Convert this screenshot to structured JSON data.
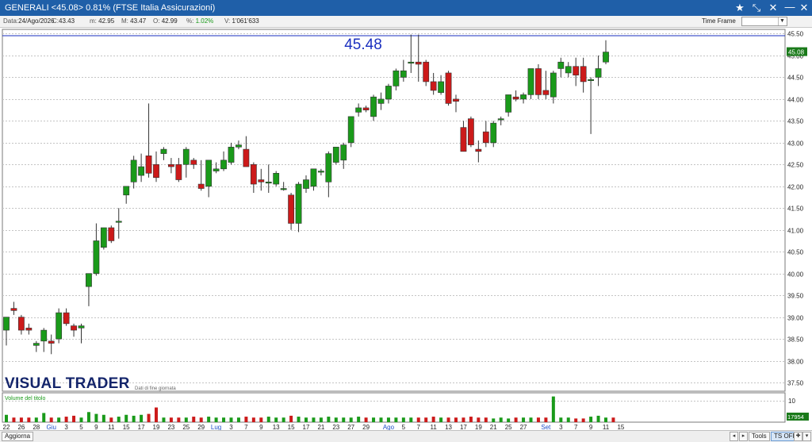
{
  "window": {
    "title": "GENERALI <45.08> 0.81%  (FTSE Italia Assicurazioni)",
    "buttons": [
      "★",
      "⤡",
      "✕",
      "—",
      "▢",
      "✕"
    ]
  },
  "infobar": {
    "date_label": "Data:",
    "date": "24/Ago/2026",
    "close_label": "C:",
    "close": "43.43",
    "min_label": "m:",
    "min": "42.95",
    "max_label": "M:",
    "max": "43.47",
    "open_label": "O:",
    "open": "42.99",
    "pct_label": "%:",
    "pct": "1.02%",
    "vol_label": "V:",
    "vol": "1'061'633",
    "timeframe_label": "Time Frame",
    "timeframe_value": ""
  },
  "chart": {
    "highlight_price": "45.48",
    "last_price_label": "45.08",
    "volume_title": "Volume del titolo",
    "volume_scale_label": "10",
    "volume_last_label": "17954",
    "brand": "VISUAL TRADER",
    "brand_note": "Dati di fine giornata",
    "colors": {
      "up": "#1a9a1a",
      "down": "#cc1a1a",
      "highlight": "#1a2fbf",
      "month": "#1f4fc8"
    }
  },
  "statusbar": {
    "refresh": "Aggiorna",
    "tools": "Tools",
    "tsoff": "TS OFF"
  },
  "chart_data": {
    "type": "candlestick",
    "title": "",
    "xlabel": "",
    "ylabel": "",
    "ylim": [
      37.3,
      45.6
    ],
    "yticks": [
      37.5,
      38.0,
      38.5,
      39.0,
      39.5,
      40.0,
      40.5,
      41.0,
      41.5,
      42.0,
      42.5,
      43.0,
      43.5,
      44.0,
      44.5,
      45.0,
      45.5
    ],
    "x_labels": [
      {
        "i": 0,
        "t": "22"
      },
      {
        "i": 2,
        "t": "26"
      },
      {
        "i": 4,
        "t": "28"
      },
      {
        "i": 6,
        "t": "Giu",
        "month": true
      },
      {
        "i": 8,
        "t": "3"
      },
      {
        "i": 10,
        "t": "5"
      },
      {
        "i": 12,
        "t": "9"
      },
      {
        "i": 14,
        "t": "11"
      },
      {
        "i": 16,
        "t": "15"
      },
      {
        "i": 18,
        "t": "17"
      },
      {
        "i": 20,
        "t": "19"
      },
      {
        "i": 22,
        "t": "23"
      },
      {
        "i": 24,
        "t": "25"
      },
      {
        "i": 26,
        "t": "29"
      },
      {
        "i": 28,
        "t": "Lug",
        "month": true
      },
      {
        "i": 30,
        "t": "3"
      },
      {
        "i": 32,
        "t": "7"
      },
      {
        "i": 34,
        "t": "9"
      },
      {
        "i": 36,
        "t": "13"
      },
      {
        "i": 38,
        "t": "15"
      },
      {
        "i": 40,
        "t": "17"
      },
      {
        "i": 42,
        "t": "21"
      },
      {
        "i": 44,
        "t": "23"
      },
      {
        "i": 46,
        "t": "27"
      },
      {
        "i": 48,
        "t": "29"
      },
      {
        "i": 51,
        "t": "Ago",
        "month": true
      },
      {
        "i": 53,
        "t": "5"
      },
      {
        "i": 55,
        "t": "7"
      },
      {
        "i": 57,
        "t": "11"
      },
      {
        "i": 59,
        "t": "13"
      },
      {
        "i": 61,
        "t": "17"
      },
      {
        "i": 63,
        "t": "19"
      },
      {
        "i": 65,
        "t": "21"
      },
      {
        "i": 67,
        "t": "25"
      },
      {
        "i": 69,
        "t": "27"
      },
      {
        "i": 72,
        "t": "Set",
        "month": true
      },
      {
        "i": 74,
        "t": "3"
      },
      {
        "i": 76,
        "t": "7"
      },
      {
        "i": 78,
        "t": "9"
      },
      {
        "i": 80,
        "t": "11"
      },
      {
        "i": 82,
        "t": "15"
      }
    ],
    "ohlc": [
      [
        38.7,
        39.0,
        38.35,
        39.0
      ],
      [
        39.2,
        39.35,
        39.05,
        39.15
      ],
      [
        39.0,
        39.05,
        38.6,
        38.7
      ],
      [
        38.75,
        38.85,
        38.6,
        38.7
      ],
      [
        38.35,
        38.45,
        38.2,
        38.4
      ],
      [
        38.45,
        38.75,
        38.2,
        38.7
      ],
      [
        38.45,
        38.6,
        38.15,
        38.4
      ],
      [
        38.5,
        39.2,
        38.4,
        39.1
      ],
      [
        39.1,
        39.2,
        38.8,
        38.85
      ],
      [
        38.8,
        38.85,
        38.55,
        38.7
      ],
      [
        38.75,
        38.85,
        38.4,
        38.8
      ],
      [
        39.7,
        40.0,
        39.25,
        40.0
      ],
      [
        40.0,
        41.15,
        39.95,
        40.75
      ],
      [
        40.6,
        41.05,
        40.55,
        41.05
      ],
      [
        41.05,
        41.1,
        40.7,
        40.75
      ],
      [
        41.2,
        41.5,
        40.8,
        41.2
      ],
      [
        41.8,
        42.0,
        41.6,
        42.0
      ],
      [
        42.1,
        42.7,
        41.95,
        42.6
      ],
      [
        42.25,
        42.75,
        42.1,
        42.45
      ],
      [
        42.7,
        43.9,
        42.2,
        42.3
      ],
      [
        42.5,
        42.8,
        42.1,
        42.2
      ],
      [
        42.75,
        42.9,
        42.6,
        42.85
      ],
      [
        42.5,
        42.65,
        42.3,
        42.45
      ],
      [
        42.5,
        42.65,
        42.1,
        42.15
      ],
      [
        42.5,
        42.9,
        42.2,
        42.85
      ],
      [
        42.6,
        42.65,
        42.4,
        42.5
      ],
      [
        42.05,
        42.6,
        41.9,
        41.95
      ],
      [
        42.0,
        42.6,
        41.75,
        42.6
      ],
      [
        42.35,
        42.55,
        42.3,
        42.4
      ],
      [
        42.4,
        42.8,
        42.35,
        42.6
      ],
      [
        42.55,
        43.0,
        42.5,
        42.9
      ],
      [
        42.9,
        43.05,
        42.85,
        42.95
      ],
      [
        42.85,
        43.15,
        42.5,
        42.45
      ],
      [
        42.5,
        42.55,
        41.85,
        42.05
      ],
      [
        42.15,
        42.4,
        41.9,
        42.1
      ],
      [
        42.1,
        42.5,
        41.85,
        42.1
      ],
      [
        42.05,
        42.35,
        42.0,
        42.3
      ],
      [
        41.95,
        42.1,
        41.9,
        41.95
      ],
      [
        41.8,
        41.85,
        41.0,
        41.15
      ],
      [
        41.15,
        42.1,
        40.95,
        42.05
      ],
      [
        41.95,
        42.25,
        41.85,
        42.15
      ],
      [
        42.0,
        42.4,
        41.9,
        42.4
      ],
      [
        42.35,
        42.4,
        42.25,
        42.35
      ],
      [
        42.1,
        42.8,
        41.75,
        42.75
      ],
      [
        42.55,
        42.9,
        42.5,
        42.9
      ],
      [
        42.6,
        43.0,
        42.4,
        42.95
      ],
      [
        43.0,
        43.6,
        42.9,
        43.6
      ],
      [
        43.7,
        43.9,
        43.6,
        43.8
      ],
      [
        43.8,
        43.85,
        43.7,
        43.75
      ],
      [
        43.6,
        44.1,
        43.5,
        44.05
      ],
      [
        43.9,
        44.15,
        43.75,
        44.0
      ],
      [
        44.0,
        44.35,
        43.9,
        44.3
      ],
      [
        44.3,
        44.7,
        44.2,
        44.65
      ],
      [
        44.5,
        44.9,
        44.4,
        44.65
      ],
      [
        44.85,
        45.48,
        44.6,
        44.85
      ],
      [
        44.85,
        45.48,
        44.4,
        44.8
      ],
      [
        44.85,
        44.9,
        44.3,
        44.4
      ],
      [
        44.4,
        44.6,
        44.1,
        44.2
      ],
      [
        44.15,
        44.55,
        44.1,
        44.4
      ],
      [
        44.6,
        44.65,
        43.85,
        43.9
      ],
      [
        44.0,
        44.1,
        43.7,
        43.95
      ],
      [
        43.35,
        43.5,
        42.8,
        42.8
      ],
      [
        43.55,
        43.6,
        42.9,
        42.95
      ],
      [
        42.85,
        43.05,
        42.55,
        42.8
      ],
      [
        43.25,
        43.5,
        42.9,
        43.0
      ],
      [
        43.0,
        43.5,
        42.9,
        43.45
      ],
      [
        43.55,
        43.6,
        43.4,
        43.55
      ],
      [
        43.7,
        44.1,
        43.6,
        44.1
      ],
      [
        44.05,
        44.2,
        43.95,
        44.0
      ],
      [
        44.0,
        44.15,
        43.9,
        44.1
      ],
      [
        44.1,
        44.7,
        44.0,
        44.7
      ],
      [
        44.7,
        44.8,
        44.0,
        44.1
      ],
      [
        44.2,
        44.65,
        44.0,
        44.1
      ],
      [
        44.05,
        44.65,
        43.9,
        44.6
      ],
      [
        44.7,
        44.95,
        44.5,
        44.85
      ],
      [
        44.6,
        44.85,
        44.5,
        44.75
      ],
      [
        44.75,
        44.95,
        44.3,
        44.55
      ],
      [
        44.75,
        44.95,
        44.15,
        44.4
      ],
      [
        44.45,
        44.5,
        43.2,
        44.45
      ],
      [
        44.5,
        45.0,
        44.3,
        44.7
      ],
      [
        44.85,
        45.35,
        44.8,
        45.08
      ]
    ],
    "volume": [
      0.8,
      0.5,
      0.5,
      0.5,
      0.5,
      1.0,
      0.5,
      0.5,
      0.6,
      0.7,
      0.5,
      1.1,
      0.9,
      0.8,
      0.5,
      0.6,
      0.8,
      0.7,
      0.8,
      0.9,
      1.6,
      0.5,
      0.5,
      0.5,
      0.5,
      0.6,
      0.5,
      0.6,
      0.5,
      0.5,
      0.5,
      0.5,
      0.6,
      0.5,
      0.5,
      0.6,
      0.5,
      0.5,
      0.7,
      0.6,
      0.5,
      0.5,
      0.5,
      0.6,
      0.5,
      0.5,
      0.5,
      0.6,
      0.5,
      0.5,
      0.5,
      0.5,
      0.5,
      0.5,
      0.5,
      0.5,
      0.5,
      0.6,
      0.5,
      0.5,
      0.5,
      0.5,
      0.6,
      0.5,
      0.5,
      0.4,
      0.5,
      0.4,
      0.5,
      0.5,
      0.5,
      0.5,
      0.5,
      2.8,
      0.5,
      0.5,
      0.4,
      0.4,
      0.6,
      0.7,
      0.5,
      0.5
    ],
    "volume_ylim": [
      0,
      3.2
    ]
  }
}
